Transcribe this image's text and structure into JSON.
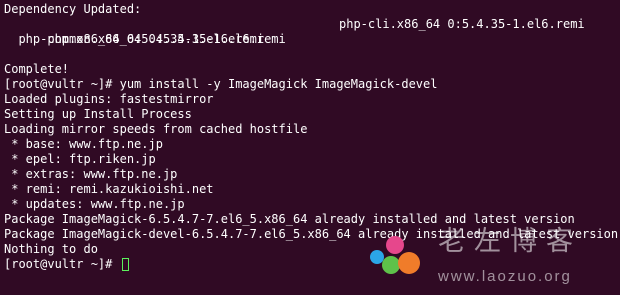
{
  "terminal": {
    "lines_top": [
      "Dependency Updated:"
    ],
    "dep_row1": {
      "left": "  php.x86_64 0:5.4.35-1.el6.remi",
      "right": "php-cli.x86_64 0:5.4.35-1.el6.remi"
    },
    "dep_row2": "  php-common.x86_64 0:5.4.35-1.el6.remi",
    "blank": "",
    "lines": [
      "Complete!",
      "[root@vultr ~]# yum install -y ImageMagick ImageMagick-devel",
      "Loaded plugins: fastestmirror",
      "Setting up Install Process",
      "Loading mirror speeds from cached hostfile",
      " * base: www.ftp.ne.jp",
      " * epel: ftp.riken.jp",
      " * extras: www.ftp.ne.jp",
      " * remi: remi.kazukioishi.net",
      " * updates: www.ftp.ne.jp",
      "Package ImageMagick-6.5.4.7-7.el6_5.x86_64 already installed and latest version",
      "Package ImageMagick-devel-6.5.4.7-7.el6_5.x86_64 already installed and latest version",
      "Nothing to do"
    ],
    "prompt": "[root@vultr ~]# "
  },
  "watermark": {
    "title": "老左博客",
    "url": "www.laozuo.org",
    "dot_colors": [
      "#e6478c",
      "#2ba6e8",
      "#5ec24a",
      "#f07c2a"
    ]
  }
}
